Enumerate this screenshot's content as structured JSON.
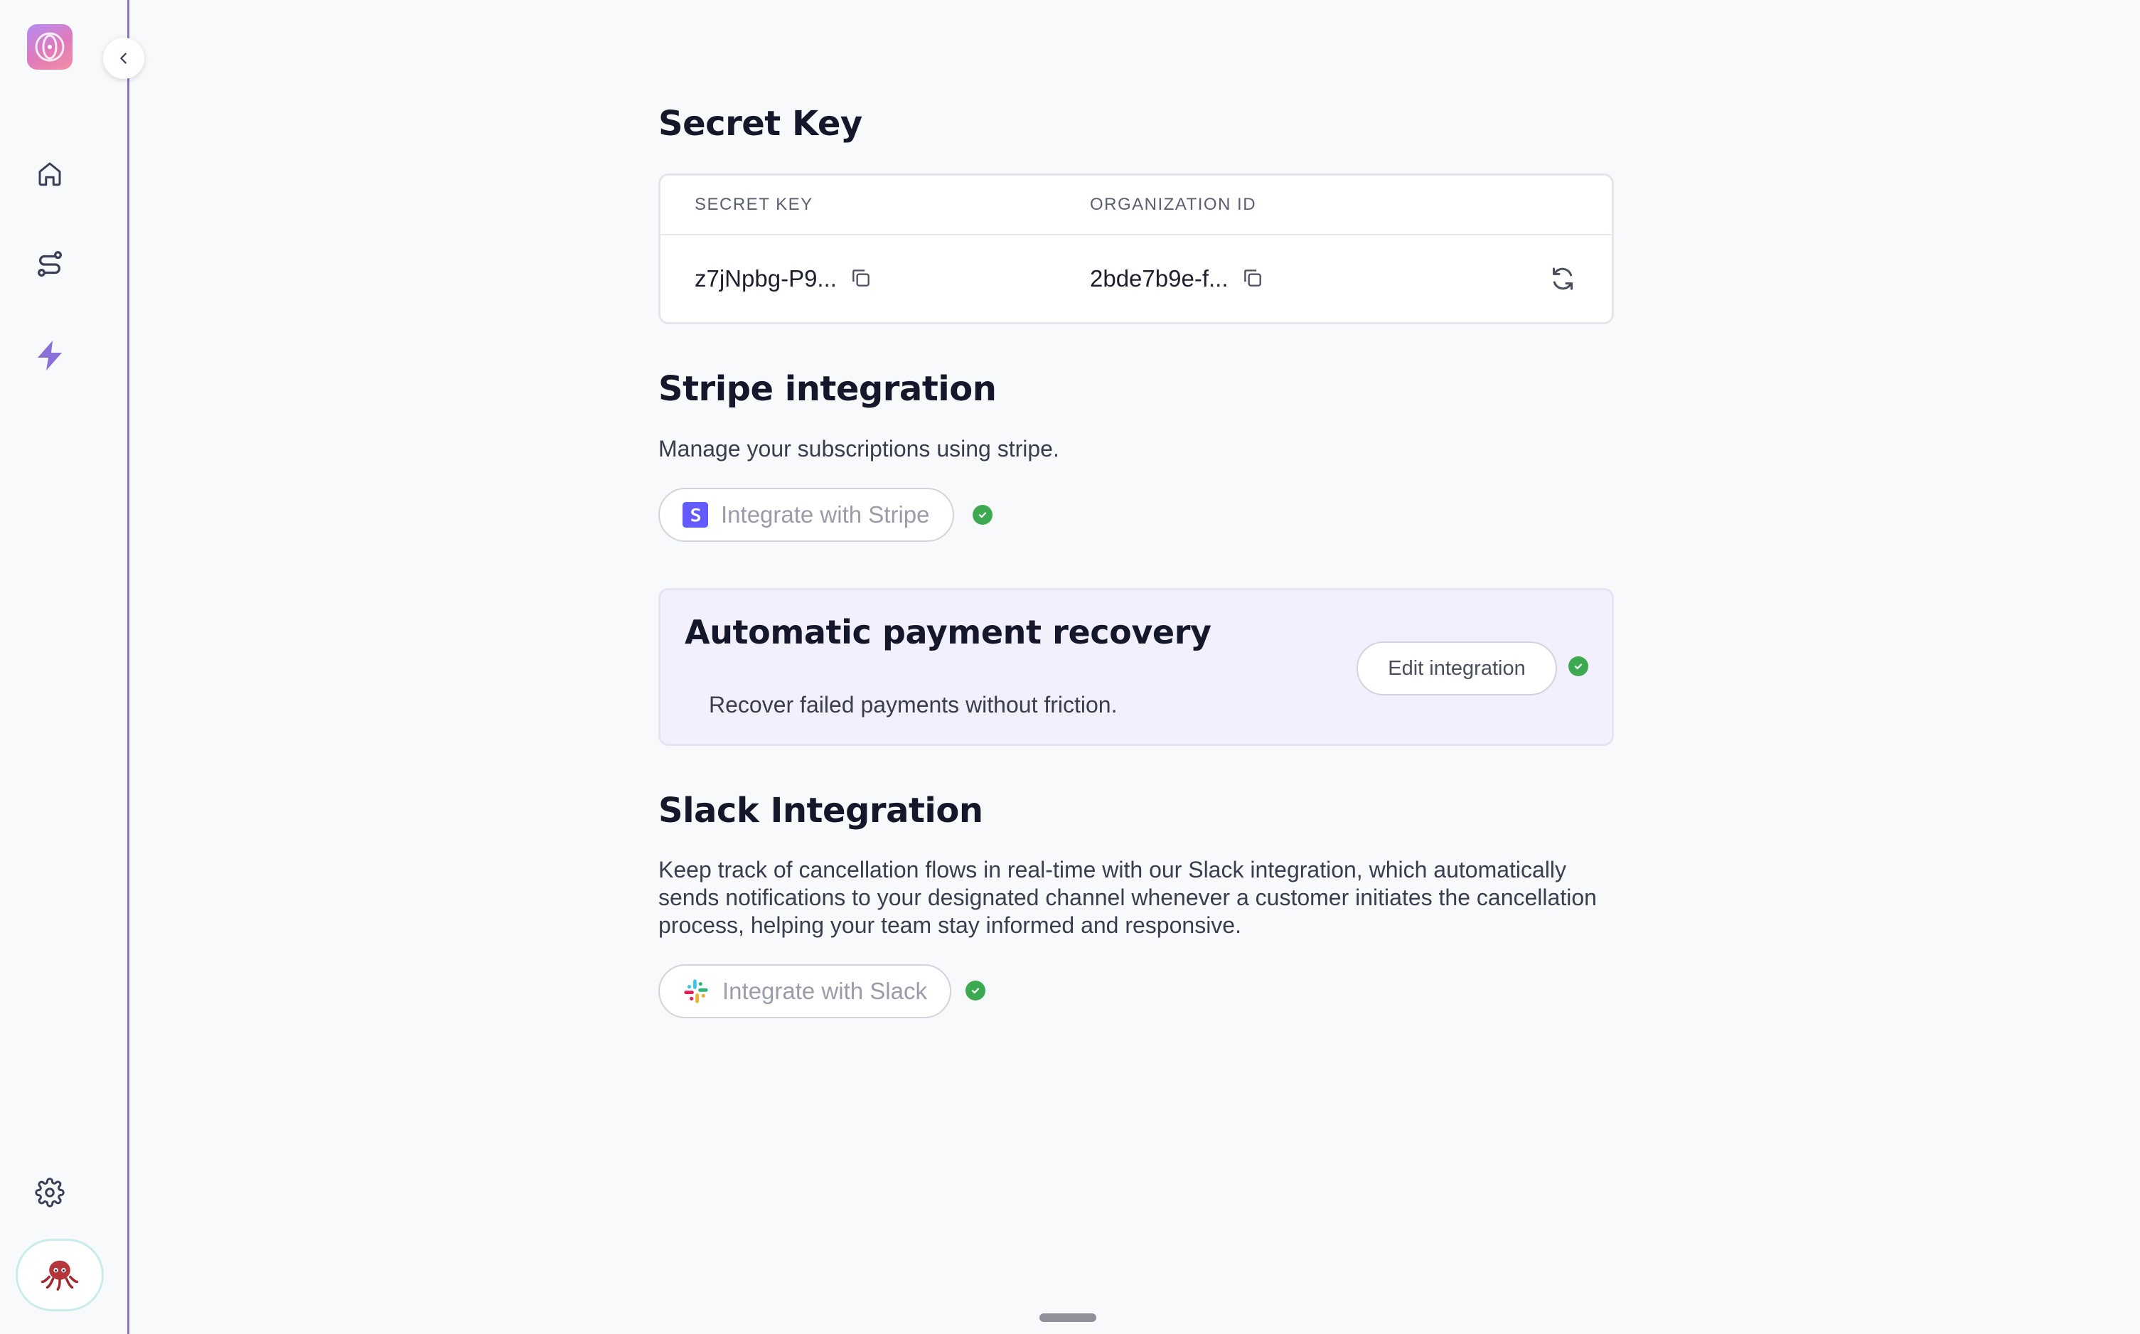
{
  "sidebar": {
    "logo_icon": "retention-app-logo-icon",
    "collapse_icon": "chevron-left-icon",
    "items": [
      {
        "name": "home",
        "icon": "home-icon"
      },
      {
        "name": "flows",
        "icon": "route-icon"
      },
      {
        "name": "integrations",
        "icon": "lightning-bolt-icon",
        "active": true
      },
      {
        "name": "settings",
        "icon": "gear-icon"
      }
    ],
    "avatar_icon": "octopus-avatar"
  },
  "secret_key": {
    "title": "Secret Key",
    "columns": [
      "SECRET KEY",
      "ORGANIZATION ID"
    ],
    "secret_key_value": "z7jNpbg-P9...",
    "organization_id_value": "2bde7b9e-f..."
  },
  "stripe": {
    "title": "Stripe integration",
    "description": "Manage your subscriptions using stripe.",
    "button_label": "Integrate with Stripe",
    "connected": true
  },
  "recovery": {
    "title": "Automatic payment recovery",
    "description": "Recover failed payments without friction.",
    "button_label": "Edit integration",
    "connected": true
  },
  "slack": {
    "title": "Slack Integration",
    "description": "Keep track of cancellation flows in real-time with our Slack integration, which automatically sends notifications to your designated channel whenever a customer initiates the cancellation process, helping your team stay informed and responsive.",
    "button_label": "Integrate with Slack",
    "connected": true
  },
  "colors": {
    "accent": "#8b6fd8",
    "success": "#3daa52",
    "stripe": "#635bff"
  }
}
